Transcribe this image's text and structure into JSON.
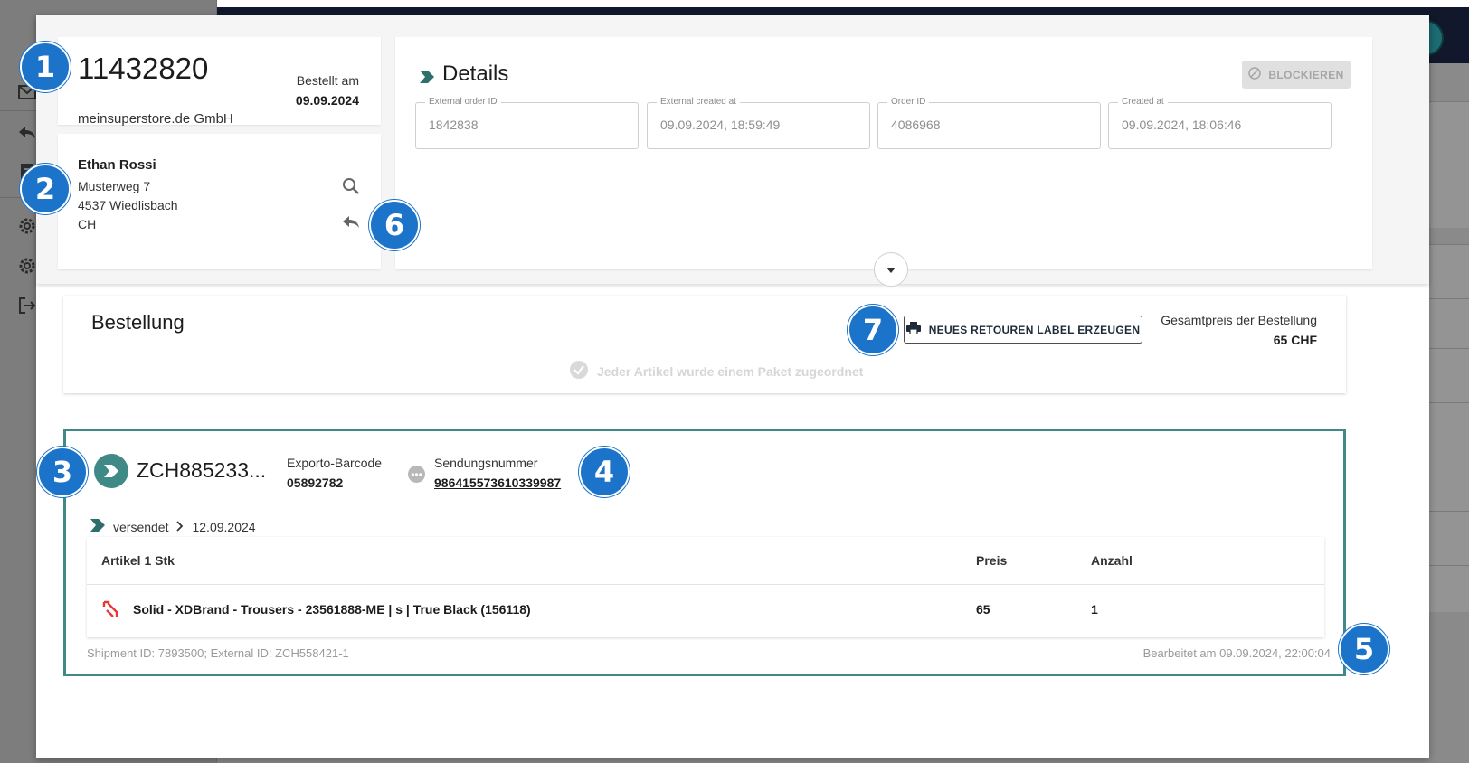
{
  "order": {
    "number": "11432820",
    "shop": "meinsuperstore.de GmbH",
    "ordered_label": "Bestellt am",
    "ordered_date": "09.09.2024"
  },
  "customer": {
    "name": "Ethan Rossi",
    "street": "Musterweg 7",
    "city": "4537 Wiedlisbach",
    "country": "CH"
  },
  "details": {
    "title": "Details",
    "block_label": "BLOCKIEREN",
    "fields": [
      {
        "label": "External order ID",
        "value": "1842838"
      },
      {
        "label": "External created at",
        "value": "09.09.2024, 18:59:49"
      },
      {
        "label": "Order ID",
        "value": "4086968"
      },
      {
        "label": "Created at",
        "value": "09.09.2024, 18:06:46"
      }
    ]
  },
  "bestellung": {
    "title": "Bestellung",
    "retour_label": "NEUES RETOUREN LABEL ERZEUGEN",
    "total_label": "Gesamtpreis der Bestellung",
    "total_value": "65 CHF",
    "assigned_text": "Jeder Artikel wurde einem Paket zugeordnet"
  },
  "shipment": {
    "id": "ZCH885233...",
    "barcode_label": "Exporto-Barcode",
    "barcode_value": "05892782",
    "sendung_label": "Sendungsnummer",
    "sendung_value": "986415573610339987",
    "status": "versendet",
    "status_date": "12.09.2024",
    "table": {
      "col_item": "Artikel 1 Stk",
      "col_price": "Preis",
      "col_qty": "Anzahl",
      "rows": [
        {
          "name": "Solid - XDBrand - Trousers - 23561888-ME | s | True Black (156118)",
          "price": "65",
          "qty": "1"
        }
      ]
    },
    "footer_left": "Shipment ID: 7893500; External ID: ZCH558421-1",
    "footer_right": "Bearbeitet am 09.09.2024, 22:00:04"
  },
  "badges": [
    "1",
    "2",
    "3",
    "4",
    "5",
    "6",
    "7"
  ],
  "colors": {
    "accent_teal": "#3f8a86",
    "badge_blue": "#1b74c9",
    "topbar": "#12182b"
  }
}
